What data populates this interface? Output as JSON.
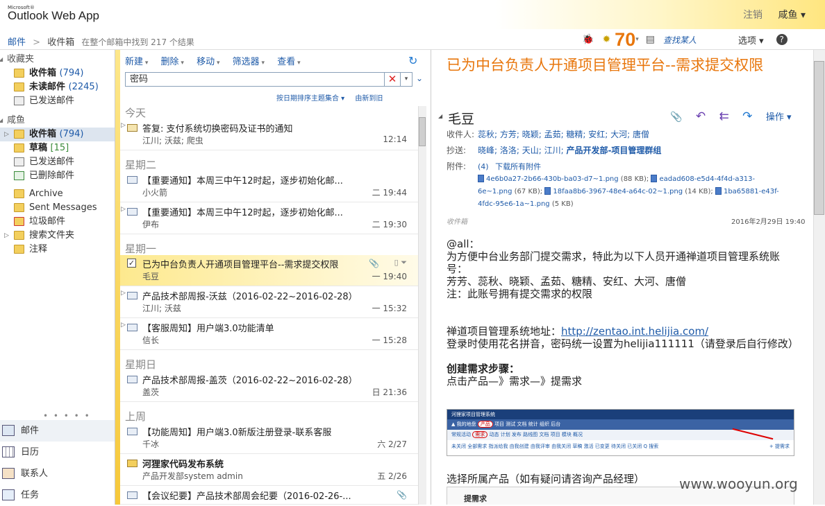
{
  "app": {
    "brand_small": "Microsoft®",
    "title": "Outlook Web App"
  },
  "user": {
    "signout": "注销",
    "name": "咸鱼 ▾"
  },
  "breadcrumb": {
    "root": "邮件",
    "sep": ">",
    "folder": "收件箱",
    "info": "在整个邮箱中找到 217 个结果"
  },
  "topright": {
    "score": "70",
    "score_dd": "▾",
    "find_people": "查找某人",
    "options": "选项 ▾",
    "help": "?"
  },
  "nav": {
    "favorites": "收藏夹",
    "fav_items": [
      {
        "label": "收件箱",
        "count": "(794)"
      },
      {
        "label": "未读邮件",
        "count": "(2245)"
      },
      {
        "label": "已发送邮件",
        "count": ""
      }
    ],
    "mailbox": "咸鱼",
    "box_items": [
      {
        "label": "收件箱",
        "count": "(794)"
      },
      {
        "label": "草稿",
        "count": "[15]"
      },
      {
        "label": "已发送邮件",
        "count": ""
      },
      {
        "label": "已删除邮件",
        "count": ""
      }
    ],
    "other_items": [
      "Archive",
      "Sent Messages",
      "垃圾邮件",
      "搜索文件夹",
      "注释"
    ],
    "dots": "• • • • •",
    "modules": [
      "邮件",
      "日历",
      "联系人",
      "任务"
    ]
  },
  "toolbar": {
    "new": "新建",
    "delete": "删除",
    "move": "移动",
    "filter": "筛选器",
    "view": "查看",
    "refresh": "↻"
  },
  "search": {
    "value": "密码",
    "clear": "✕",
    "dd": "▾",
    "collapse": "⌄"
  },
  "sort": {
    "by_date": "按日期排序主题集合 ▾",
    "order": "由新到旧"
  },
  "groups": [
    "今天",
    "星期二",
    "星期一",
    "星期日",
    "上周"
  ],
  "mails": [
    {
      "subject": "答复: 支付系统切换密码及证书的通知",
      "from": "江川; 沃兹; 爬虫",
      "time": "12:14"
    },
    {
      "subject": "【重要通知】本周三中午12时起，逐步初始化邮...",
      "from": "小火箭",
      "time": "二 19:44"
    },
    {
      "subject": "【重要通知】本周三中午12时起，逐步初始化邮...",
      "from": "伊布",
      "time": "二 19:30"
    },
    {
      "subject": "已为中台负责人开通项目管理平台--需求提交权限",
      "from": "毛豆",
      "time": "一 19:40",
      "check": "✓",
      "flags": "▯ ⏷"
    },
    {
      "subject": "产品技术部周报-沃兹（2016-02-22~2016-02-28）",
      "from": "江川; 沃兹",
      "time": "一 15:32"
    },
    {
      "subject": "【客服周知】用户端3.0功能清单",
      "from": "信长",
      "time": "一 15:28"
    },
    {
      "subject": "产品技术部周报-盖茨（2016-02-22~2016-02-28）",
      "from": "盖茨",
      "time": "日 21:36"
    },
    {
      "subject": "【功能周知】用户端3.0新版注册登录-联系客服",
      "from": "千冰",
      "time": "六 2/27"
    },
    {
      "subject": "河狸家代码发布系统",
      "from": "产品开发部system admin",
      "time": "五 2/26"
    },
    {
      "subject": "【会议纪要】产品技术部周会纪要（2016-02-26-...",
      "from": "",
      "time": ""
    }
  ],
  "reading": {
    "title": "已为中台负责人开通项目管理平台--需求提交权限",
    "sender": "毛豆",
    "ops": "操作 ▾",
    "to_label": "收件人:",
    "to": "蕊秋; 方芳; 晓颖; 孟茹; 糖精; 安红; 大河; 唐僧",
    "cc_label": "抄送:",
    "cc": "晓峰; 洛洛; 天山; 江川;",
    "cc_group": "产品开发部-项目管理群组",
    "att_label": "附件:",
    "att_count": "(4)",
    "att_all": "下载所有附件",
    "attachments": [
      {
        "name": "4e6b0a27-2b66-430b-ba03-d7~1.png",
        "size": "(88 KB);"
      },
      {
        "name": "eadad608-e5d4-4f4d-a313-6e~1.png",
        "size": "(67 KB);"
      },
      {
        "name": "18faa8b6-3967-48e4-a64c-02~1.png",
        "size": "(14 KB);"
      },
      {
        "name": "1ba65881-e43f-4fdc-95e6-1a~1.png",
        "size": "(5 KB)"
      }
    ],
    "folder": "收件箱",
    "date": "2016年2月29日 19:40",
    "body": {
      "l1": "@all：",
      "l2": "为方便中台业务部门提交需求，特此为以下人员开通禅道项目管理系统账号：",
      "l3": "芳芳、蕊秋、晓颖、孟茹、糖精、安红、大河、唐僧",
      "l4": "注：此账号拥有提交需求的权限",
      "addr_label": "禅道项目管理系统地址：",
      "addr": "http://zentao.int.helijia.com/",
      "login": "登录时使用花名拼音，密码统一设置为helijia111111（请登录后自行修改）",
      "steps_title": "创建需求步骤：",
      "steps": "点击产品—》需求—》提需求",
      "select": "选择所属产品（如有疑问请咨询产品经理）"
    },
    "shot": {
      "title": "河狸家项目管理系统",
      "menu": "▲ 我的地盘",
      "menu_active": "产品",
      "menu_rest": "项目  测试  文档  统计  组织  后台",
      "sub": "常规活动",
      "sub_active": "需求",
      "sub_rest": "动态  计划  发布  路线图  文档  项目  模块  概况",
      "row": "未关闭  全部需求  指派给我  由我创建  由我评审  由我关闭  草稿  激活  已变更  待关闭  已关闭  Q 搜索",
      "row_right": "+ 提需求",
      "bottom": "提需求"
    }
  },
  "watermark": "www.wooyun.org"
}
